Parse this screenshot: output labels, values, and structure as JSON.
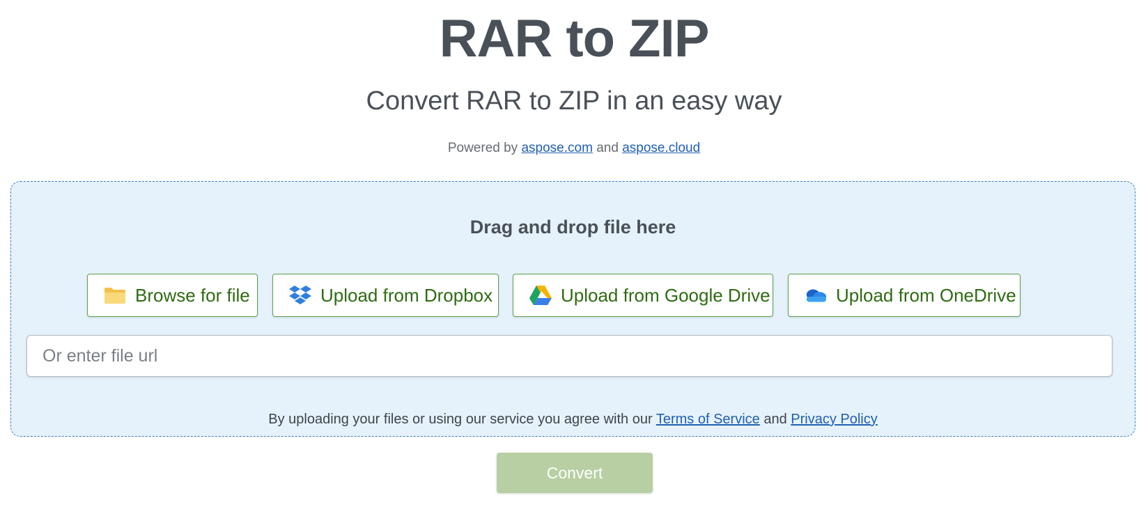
{
  "header": {
    "title": "RAR to ZIP",
    "subtitle": "Convert RAR to ZIP in an easy way",
    "powered_prefix": "Powered by",
    "powered_link1": "aspose.com",
    "powered_and": "and",
    "powered_link2": "aspose.cloud"
  },
  "dropzone": {
    "label": "Drag and drop file here",
    "buttons": [
      {
        "label": "Browse for file",
        "icon": "folder-icon"
      },
      {
        "label": "Upload from Dropbox",
        "icon": "dropbox-icon"
      },
      {
        "label": "Upload from Google Drive",
        "icon": "google-drive-icon"
      },
      {
        "label": "Upload from OneDrive",
        "icon": "onedrive-icon"
      }
    ],
    "url_placeholder": "Or enter file url",
    "url_value": "",
    "terms_prefix": "By uploading your files or using our service you agree with our",
    "terms_link": "Terms of Service",
    "terms_and": "and",
    "privacy_link": "Privacy Policy"
  },
  "convert_label": "Convert",
  "colors": {
    "accent_green": "#2e6b12",
    "link_blue": "#1f5fb3",
    "dropzone_bg": "#e6f2fb",
    "convert_disabled": "#b7cfa3"
  }
}
